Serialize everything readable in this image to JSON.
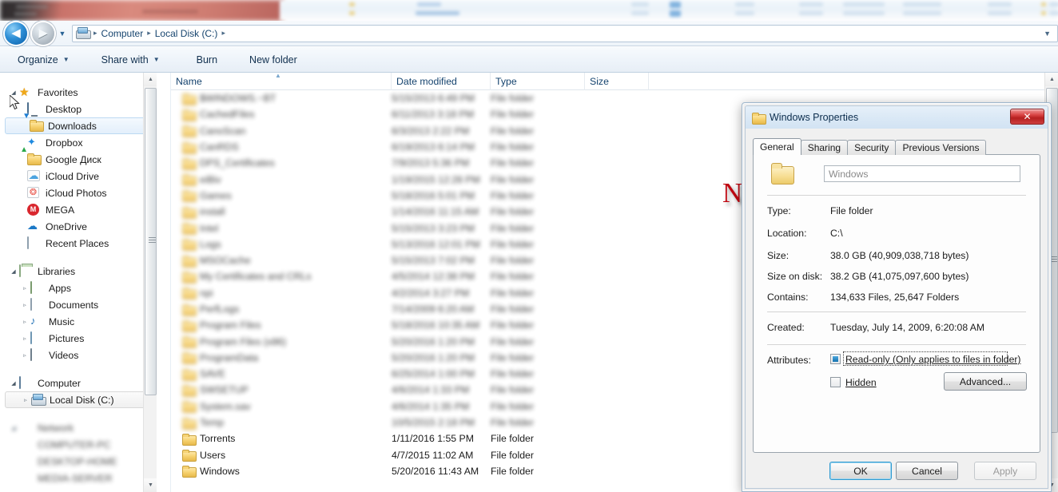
{
  "window": {
    "address": {
      "back_label": "◀",
      "forward_label": "▶",
      "history_caret": "▼",
      "crumbs": [
        "Computer",
        "Local Disk (C:)"
      ],
      "separator": "▸",
      "end_caret": "▼"
    },
    "commandbar": [
      {
        "label": "Organize",
        "caret": "▼"
      },
      {
        "label": "Share with",
        "caret": "▼"
      },
      {
        "label": "Burn",
        "caret": ""
      },
      {
        "label": "New folder",
        "caret": ""
      }
    ]
  },
  "sidebar": {
    "groups": [
      {
        "header": {
          "label": "Favorites",
          "icon": "star-icon",
          "twisty": "◢"
        },
        "items": [
          {
            "label": "Desktop",
            "icon": "desktop-icon",
            "selected": false
          },
          {
            "label": "Downloads",
            "icon": "downloads-folder-icon",
            "selected": true
          },
          {
            "label": "Dropbox",
            "icon": "dropbox-icon",
            "selected": false
          },
          {
            "label": "Google Диск",
            "icon": "google-drive-folder-icon",
            "selected": false
          },
          {
            "label": "iCloud Drive",
            "icon": "icloud-drive-icon",
            "selected": false
          },
          {
            "label": "iCloud Photos",
            "icon": "icloud-photos-icon",
            "selected": false
          },
          {
            "label": "MEGA",
            "icon": "mega-icon",
            "selected": false
          },
          {
            "label": "OneDrive",
            "icon": "onedrive-icon",
            "selected": false
          },
          {
            "label": "Recent Places",
            "icon": "recent-places-icon",
            "selected": false
          }
        ]
      },
      {
        "header": {
          "label": "Libraries",
          "icon": "libraries-icon",
          "twisty": "◢"
        },
        "items": [
          {
            "label": "Apps",
            "icon": "apps-icon",
            "twisty": "▹"
          },
          {
            "label": "Documents",
            "icon": "documents-icon",
            "twisty": "▹"
          },
          {
            "label": "Music",
            "icon": "music-icon",
            "twisty": "▹"
          },
          {
            "label": "Pictures",
            "icon": "pictures-icon",
            "twisty": "▹"
          },
          {
            "label": "Videos",
            "icon": "videos-icon",
            "twisty": "▹"
          }
        ]
      },
      {
        "header": {
          "label": "Computer",
          "icon": "computer-icon",
          "twisty": "◢"
        },
        "items": [
          {
            "label": "Local Disk (C:)",
            "icon": "local-disk-icon",
            "twisty": "▹",
            "selected": true
          }
        ]
      },
      {
        "header": {
          "label": "Network",
          "icon": "network-icon",
          "twisty": "◢",
          "blurred": true
        },
        "items": [
          {
            "label": "COMPUTER-PC",
            "blurred": true
          },
          {
            "label": "DESKTOP-HOME",
            "blurred": true
          },
          {
            "label": "MEDIA-SERVER",
            "blurred": true
          }
        ]
      }
    ]
  },
  "filelist": {
    "columns": [
      {
        "label": "Name"
      },
      {
        "label": "Date modified"
      },
      {
        "label": "Type"
      },
      {
        "label": "Size"
      }
    ],
    "sort_indicator": "▲",
    "rows": [
      {
        "name": "$WINDOWS.~BT",
        "date": "5/15/2013 6:49 PM",
        "type": "File folder",
        "blurred": true
      },
      {
        "name": "CachedFiles",
        "date": "6/11/2013 3:18 PM",
        "type": "File folder",
        "blurred": true
      },
      {
        "name": "CanoScan",
        "date": "6/3/2013 2:22 PM",
        "type": "File folder",
        "blurred": true
      },
      {
        "name": "CanRDS",
        "date": "6/19/2013 6:14 PM",
        "type": "File folder",
        "blurred": true
      },
      {
        "name": "DPS_Certificates",
        "date": "7/9/2013 5:36 PM",
        "type": "File folder",
        "blurred": true
      },
      {
        "name": "eiBiv",
        "date": "1/19/2015 12:28 PM",
        "type": "File folder",
        "blurred": true
      },
      {
        "name": "Games",
        "date": "5/18/2016 5:01 PM",
        "type": "File folder",
        "blurred": true
      },
      {
        "name": "install",
        "date": "1/14/2016 11:15 AM",
        "type": "File folder",
        "blurred": true
      },
      {
        "name": "Intel",
        "date": "5/15/2013 3:23 PM",
        "type": "File folder",
        "blurred": true
      },
      {
        "name": "Logs",
        "date": "5/13/2016 12:01 PM",
        "type": "File folder",
        "blurred": true
      },
      {
        "name": "MSOCache",
        "date": "5/15/2013 7:02 PM",
        "type": "File folder",
        "blurred": true
      },
      {
        "name": "My Certificates and CRLs",
        "date": "4/5/2014 12:38 PM",
        "type": "File folder",
        "blurred": true
      },
      {
        "name": "npi",
        "date": "4/2/2014 3:27 PM",
        "type": "File folder",
        "blurred": true
      },
      {
        "name": "PerfLogs",
        "date": "7/14/2009 6:20 AM",
        "type": "File folder",
        "blurred": true
      },
      {
        "name": "Program Files",
        "date": "5/18/2016 10:35 AM",
        "type": "File folder",
        "blurred": true
      },
      {
        "name": "Program Files (x86)",
        "date": "5/20/2016 1:20 PM",
        "type": "File folder",
        "blurred": true
      },
      {
        "name": "ProgramData",
        "date": "5/20/2016 1:20 PM",
        "type": "File folder",
        "blurred": true
      },
      {
        "name": "SAVE",
        "date": "6/25/2014 1:00 PM",
        "type": "File folder",
        "blurred": true
      },
      {
        "name": "SWSETUP",
        "date": "4/6/2014 1:33 PM",
        "type": "File folder",
        "blurred": true
      },
      {
        "name": "System.sav",
        "date": "4/6/2014 1:35 PM",
        "type": "File folder",
        "blurred": true
      },
      {
        "name": "Temp",
        "date": "10/5/2015 2:18 PM",
        "type": "File folder",
        "blurred": true
      },
      {
        "name": "Torrents",
        "date": "1/11/2016 1:55 PM",
        "type": "File folder",
        "blurred": false
      },
      {
        "name": "Users",
        "date": "4/7/2015 11:02 AM",
        "type": "File folder",
        "blurred": false
      },
      {
        "name": "Windows",
        "date": "5/20/2016 11:43 AM",
        "type": "File folder",
        "blurred": false
      }
    ]
  },
  "watermark": {
    "text": "NOTHING",
    "color": "#c00812"
  },
  "dialog": {
    "title": "Windows Properties",
    "close_label": "✕",
    "tabs": [
      {
        "label": "General",
        "active": true
      },
      {
        "label": "Sharing",
        "active": false
      },
      {
        "label": "Security",
        "active": false
      },
      {
        "label": "Previous Versions",
        "active": false
      }
    ],
    "name_value": "Windows",
    "fields": [
      {
        "label": "Type:",
        "value": "File folder"
      },
      {
        "label": "Location:",
        "value": "C:\\"
      },
      {
        "label": "Size:",
        "value": "38.0 GB (40,909,038,718 bytes)"
      },
      {
        "label": "Size on disk:",
        "value": "38.2 GB (41,075,097,600 bytes)"
      },
      {
        "label": "Contains:",
        "value": "134,633 Files, 25,647 Folders"
      }
    ],
    "created": {
      "label": "Created:",
      "value": "Tuesday, July 14, 2009, 6:20:08 AM"
    },
    "attributes": {
      "label": "Attributes:",
      "readonly": {
        "label": "Read-only (Only applies to files in folder)",
        "state": "filled"
      },
      "hidden": {
        "label": "Hidden",
        "state": "unchecked"
      },
      "advanced_label": "Advanced..."
    },
    "buttons": {
      "ok": "OK",
      "cancel": "Cancel",
      "apply": "Apply"
    }
  }
}
